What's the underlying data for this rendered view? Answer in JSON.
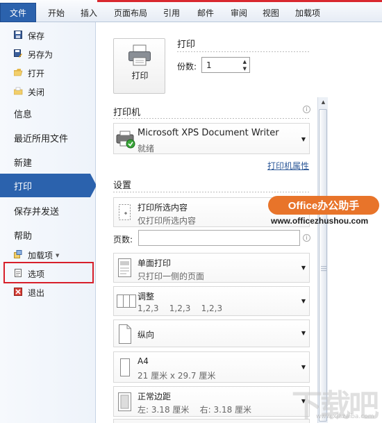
{
  "ribbon": {
    "tabs": [
      "文件",
      "开始",
      "插入",
      "页面布局",
      "引用",
      "邮件",
      "审阅",
      "视图",
      "加载项"
    ]
  },
  "left_menu": {
    "small_items": [
      {
        "label": "保存",
        "icon": "save-icon"
      },
      {
        "label": "另存为",
        "icon": "save-as-icon"
      },
      {
        "label": "打开",
        "icon": "open-folder-icon"
      },
      {
        "label": "关闭",
        "icon": "close-folder-icon"
      }
    ],
    "big_items": [
      "信息",
      "最近所用文件",
      "新建",
      "打印",
      "保存并发送",
      "帮助"
    ],
    "bottom_items": [
      {
        "label": "加载项",
        "icon": "addins-icon",
        "has_dropdown": true
      },
      {
        "label": "选项",
        "icon": "options-icon"
      },
      {
        "label": "退出",
        "icon": "exit-icon"
      }
    ],
    "selected": "打印"
  },
  "print": {
    "section_title": "打印",
    "button_label": "打印",
    "copies_label": "份数:",
    "copies_value": "1"
  },
  "printer": {
    "section_title": "打印机",
    "name": "Microsoft XPS Document Writer",
    "status": "就绪",
    "properties_link": "打印机属性"
  },
  "settings": {
    "section_title": "设置",
    "scope": {
      "main": "打印所选内容",
      "sub": "仅打印所选内容"
    },
    "pages_label": "页数:",
    "pages_value": "",
    "sides": {
      "main": "单面打印",
      "sub": "只打印一侧的页面"
    },
    "collate": {
      "main": "调整",
      "sub": "1,2,3    1,2,3    1,2,3"
    },
    "orientation": {
      "main": "纵向"
    },
    "paper": {
      "main": "A4",
      "sub": "21 厘米 x 29.7 厘米"
    },
    "margins": {
      "main": "正常边距",
      "sub": "左: 3.18 厘米    右: 3.18 厘米"
    }
  },
  "watermark": {
    "badge": "Office办公助手",
    "url": "www.officezhushou.com",
    "logo": "下载吧",
    "logo_url": "www.xiazaiba.com"
  },
  "colors": {
    "accent": "#2b62ad",
    "highlight_box": "#d71f2a",
    "watermark_badge": "#e8742a"
  }
}
